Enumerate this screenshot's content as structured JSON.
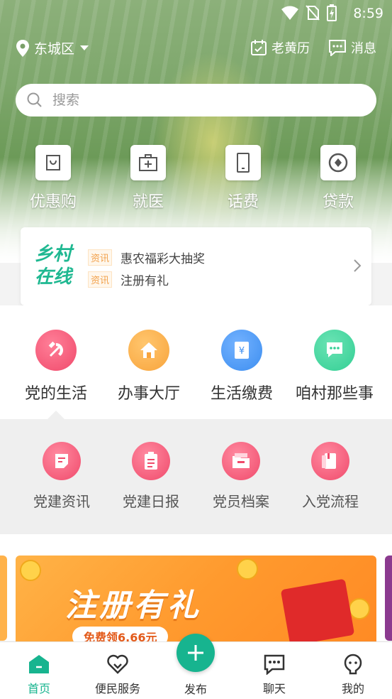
{
  "status_bar": {
    "time": "8:59"
  },
  "header": {
    "location": "东城区",
    "calendar_label": "老黄历",
    "message_label": "消息"
  },
  "search": {
    "placeholder": "搜索"
  },
  "quick_actions": [
    {
      "label": "优惠购",
      "icon": "shopping-bag-icon"
    },
    {
      "label": "就医",
      "icon": "medical-kit-icon"
    },
    {
      "label": "话费",
      "icon": "phone-icon"
    },
    {
      "label": "贷款",
      "icon": "loan-icon"
    }
  ],
  "news": {
    "logo_line1": "乡村",
    "logo_line2": "在线",
    "items": [
      {
        "tag": "资讯",
        "text": "惠农福彩大抽奖"
      },
      {
        "tag": "资讯",
        "text": "注册有礼"
      }
    ]
  },
  "categories": [
    {
      "label": "党的生活",
      "icon": "party-emblem-icon",
      "color": "#f04a6b"
    },
    {
      "label": "办事大厅",
      "icon": "house-icon",
      "color": "#f8a43c"
    },
    {
      "label": "生活缴费",
      "icon": "yuan-bill-icon",
      "color": "#3d8ef0"
    },
    {
      "label": "咱村那些事",
      "icon": "chat-bubble-icon",
      "color": "#33cf94"
    }
  ],
  "party_items": [
    {
      "label": "党建资讯",
      "icon": "document-icon"
    },
    {
      "label": "党建日报",
      "icon": "clipboard-icon"
    },
    {
      "label": "党员档案",
      "icon": "archive-icon"
    },
    {
      "label": "入党流程",
      "icon": "booklet-icon"
    }
  ],
  "banner": {
    "title": "注册有礼",
    "subtitle": "免费领6.66元"
  },
  "tabbar": {
    "items": [
      {
        "label": "首页",
        "icon": "home-icon"
      },
      {
        "label": "便民服务",
        "icon": "heart-icon"
      },
      {
        "label": "发布",
        "icon": "plus-icon"
      },
      {
        "label": "聊天",
        "icon": "chat-icon"
      },
      {
        "label": "我的",
        "icon": "profile-icon"
      }
    ]
  },
  "colors": {
    "accent": "#17b48f",
    "party": "#f04a6b"
  }
}
